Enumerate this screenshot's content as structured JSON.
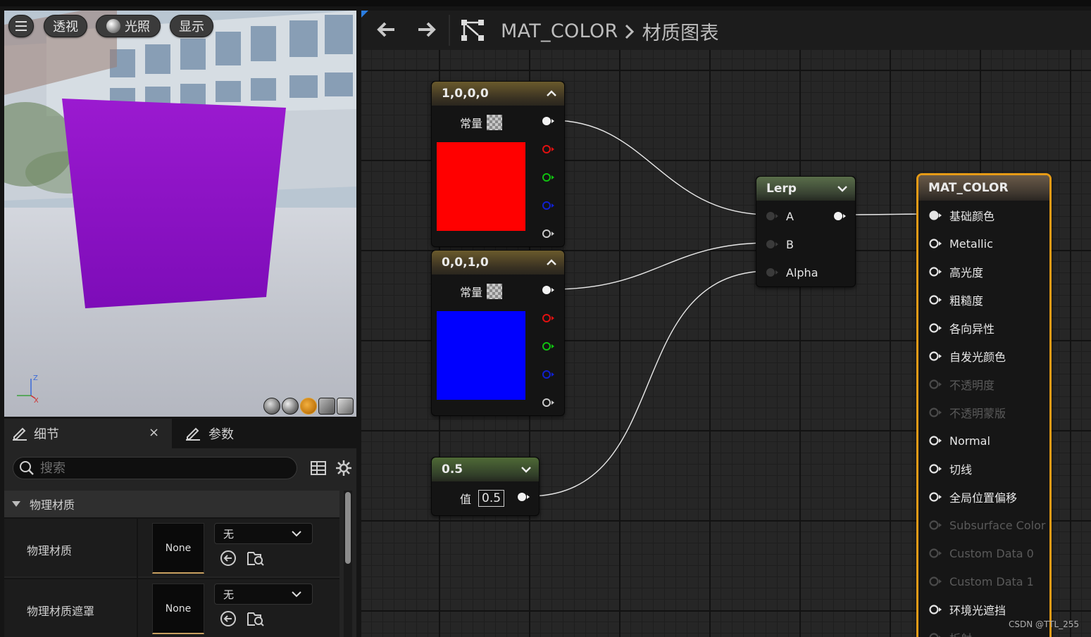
{
  "viewport": {
    "menu_icon": "hamburger-icon",
    "perspective_label": "透视",
    "lighting_label": "光照",
    "show_label": "显示",
    "axis": {
      "z": "Z",
      "x": "X"
    },
    "preview_color": "#8a10c8"
  },
  "details": {
    "tab_details": "细节",
    "tab_close": "×",
    "tab_params": "参数",
    "search_placeholder": "搜索",
    "category": "物理材质",
    "rows": [
      {
        "label": "物理材质",
        "thumb": "None",
        "combo": "无"
      },
      {
        "label": "物理材质遮罩",
        "thumb": "None",
        "combo": "无"
      }
    ]
  },
  "graph": {
    "breadcrumb_asset": "MAT_COLOR",
    "breadcrumb_sep": "›",
    "breadcrumb_graph": "材质图表"
  },
  "nodes": {
    "const_red": {
      "title": "1,0,0,0",
      "pin_label": "常量",
      "color": "#ff0000"
    },
    "const_blue": {
      "title": "0,0,1,0",
      "pin_label": "常量",
      "color": "#0000ff"
    },
    "scalar": {
      "title": "0.5",
      "pin_label": "值",
      "value": "0.5"
    },
    "lerp": {
      "title": "Lerp",
      "inputs": [
        "A",
        "B",
        "Alpha"
      ]
    },
    "material": {
      "title": "MAT_COLOR",
      "pins": [
        {
          "label": "基础颜色",
          "enabled": true,
          "connected": true
        },
        {
          "label": "Metallic",
          "enabled": true,
          "connected": false
        },
        {
          "label": "高光度",
          "enabled": true,
          "connected": false
        },
        {
          "label": "粗糙度",
          "enabled": true,
          "connected": false
        },
        {
          "label": "各向异性",
          "enabled": true,
          "connected": false
        },
        {
          "label": "自发光颜色",
          "enabled": true,
          "connected": false
        },
        {
          "label": "不透明度",
          "enabled": false,
          "connected": false
        },
        {
          "label": "不透明蒙版",
          "enabled": false,
          "connected": false
        },
        {
          "label": "Normal",
          "enabled": true,
          "connected": false
        },
        {
          "label": "切线",
          "enabled": true,
          "connected": false
        },
        {
          "label": "全局位置偏移",
          "enabled": true,
          "connected": false
        },
        {
          "label": "Subsurface Color",
          "enabled": false,
          "connected": false
        },
        {
          "label": "Custom Data 0",
          "enabled": false,
          "connected": false
        },
        {
          "label": "Custom Data 1",
          "enabled": false,
          "connected": false
        },
        {
          "label": "环境光遮挡",
          "enabled": true,
          "connected": false
        },
        {
          "label": "折射",
          "enabled": false,
          "connected": false
        }
      ]
    }
  },
  "watermark": "CSDN @TTL_255"
}
